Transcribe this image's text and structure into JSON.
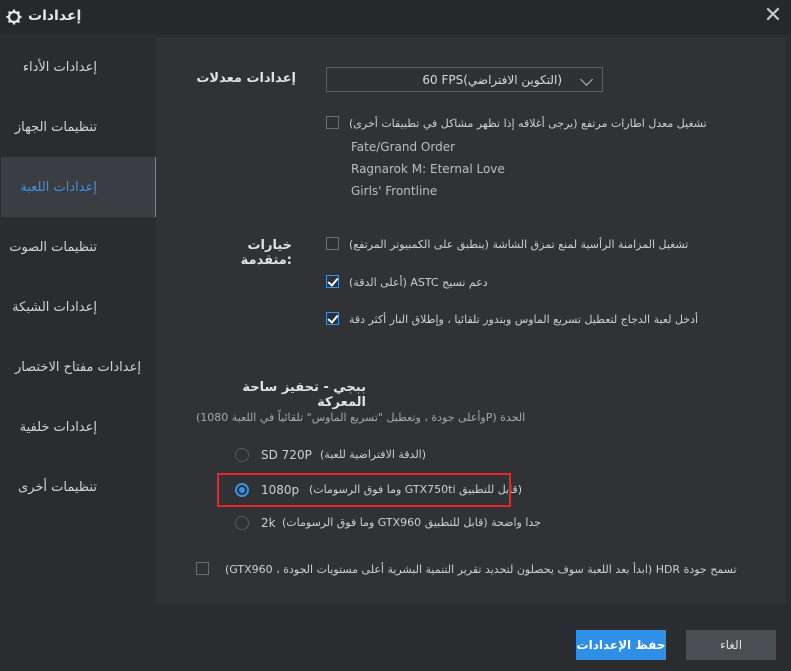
{
  "window": {
    "title": "إعدادات",
    "close_glyph": "✕"
  },
  "sidebar": {
    "items": [
      {
        "label": "إعدادات الأداء"
      },
      {
        "label": "تنظيمات الجهاز"
      },
      {
        "label": "إعدادات اللعبة"
      },
      {
        "label": "تنظيمات الصوت"
      },
      {
        "label": "إعدادات الشبكة"
      },
      {
        "label": "إعدادات مفتاح الاختصار"
      },
      {
        "label": "إعدادات خلفية"
      },
      {
        "label": "تنظيمات أخرى"
      }
    ],
    "active_index": 2
  },
  "frame_rate": {
    "label": "إعدادات معدلات",
    "dropdown_value": "60 FPS(التكوين الافتراضي)",
    "high_fps_option": "(يرجى أغلاقه إذا تظهر مشاكل في تطبيقات أخرى)  تشغيل معدل اطارات مرتفع",
    "high_fps_checked": false,
    "games": [
      "Fate/Grand Order",
      "Ragnarok M: Eternal Love",
      "Girls' Frontline"
    ]
  },
  "advanced": {
    "label": "خيارات متقدمة:",
    "options": [
      {
        "text": "(ينطبق على الكمبيوتر المرتفع)   تشغيل المزامنة الرأسية لمنع تمزق الشاشة",
        "checked": false
      },
      {
        "text": "(أعلى الدقة)   ASTC دعم نسيج",
        "checked": true
      },
      {
        "text": "أدخل لعبة الدجاج لتعطيل تسريع الماوس وبندور تلقائيا ، وإطلاق النار أكثر دقة",
        "checked": true
      }
    ]
  },
  "pubg": {
    "title": "ببجي - تحفيز ساحة المعركة",
    "subtitle": "(وأعلى جودة ، وتعطيل \"تسريع الماوس\" تلقائياً في اللعبة 1080P)  الحدة",
    "resolutions": [
      {
        "label": "SD 720P",
        "note": "(الدقة الافتراضية للعبة)",
        "selected": false
      },
      {
        "label": "1080p",
        "note": "(وما فوق الرسومات GTX750ti قابل للتطبيق)",
        "selected": true
      },
      {
        "label": "2k",
        "note": "(وما فوق الرسومات GTX960 قابل للتطبيق)  جدا واضحة",
        "selected": false
      }
    ],
    "hdr_text": "(GTX960 ، ابدأ بعد اللعبة سوف يحصلون لتحديد تقرير التنمية البشرية أعلى مستويات الجودة)   HDR تسمح جودة",
    "hdr_checked": false
  },
  "footer": {
    "save_label": "حفظ الإعدادات",
    "cancel_label": "الغاء"
  },
  "colors": {
    "accent": "#3a92e8",
    "highlight": "#e32a2a",
    "background": "#2b2d30"
  },
  "icons": {
    "title": "gear-icon",
    "close": "close-icon",
    "dropdown": "chevron-down-icon"
  }
}
